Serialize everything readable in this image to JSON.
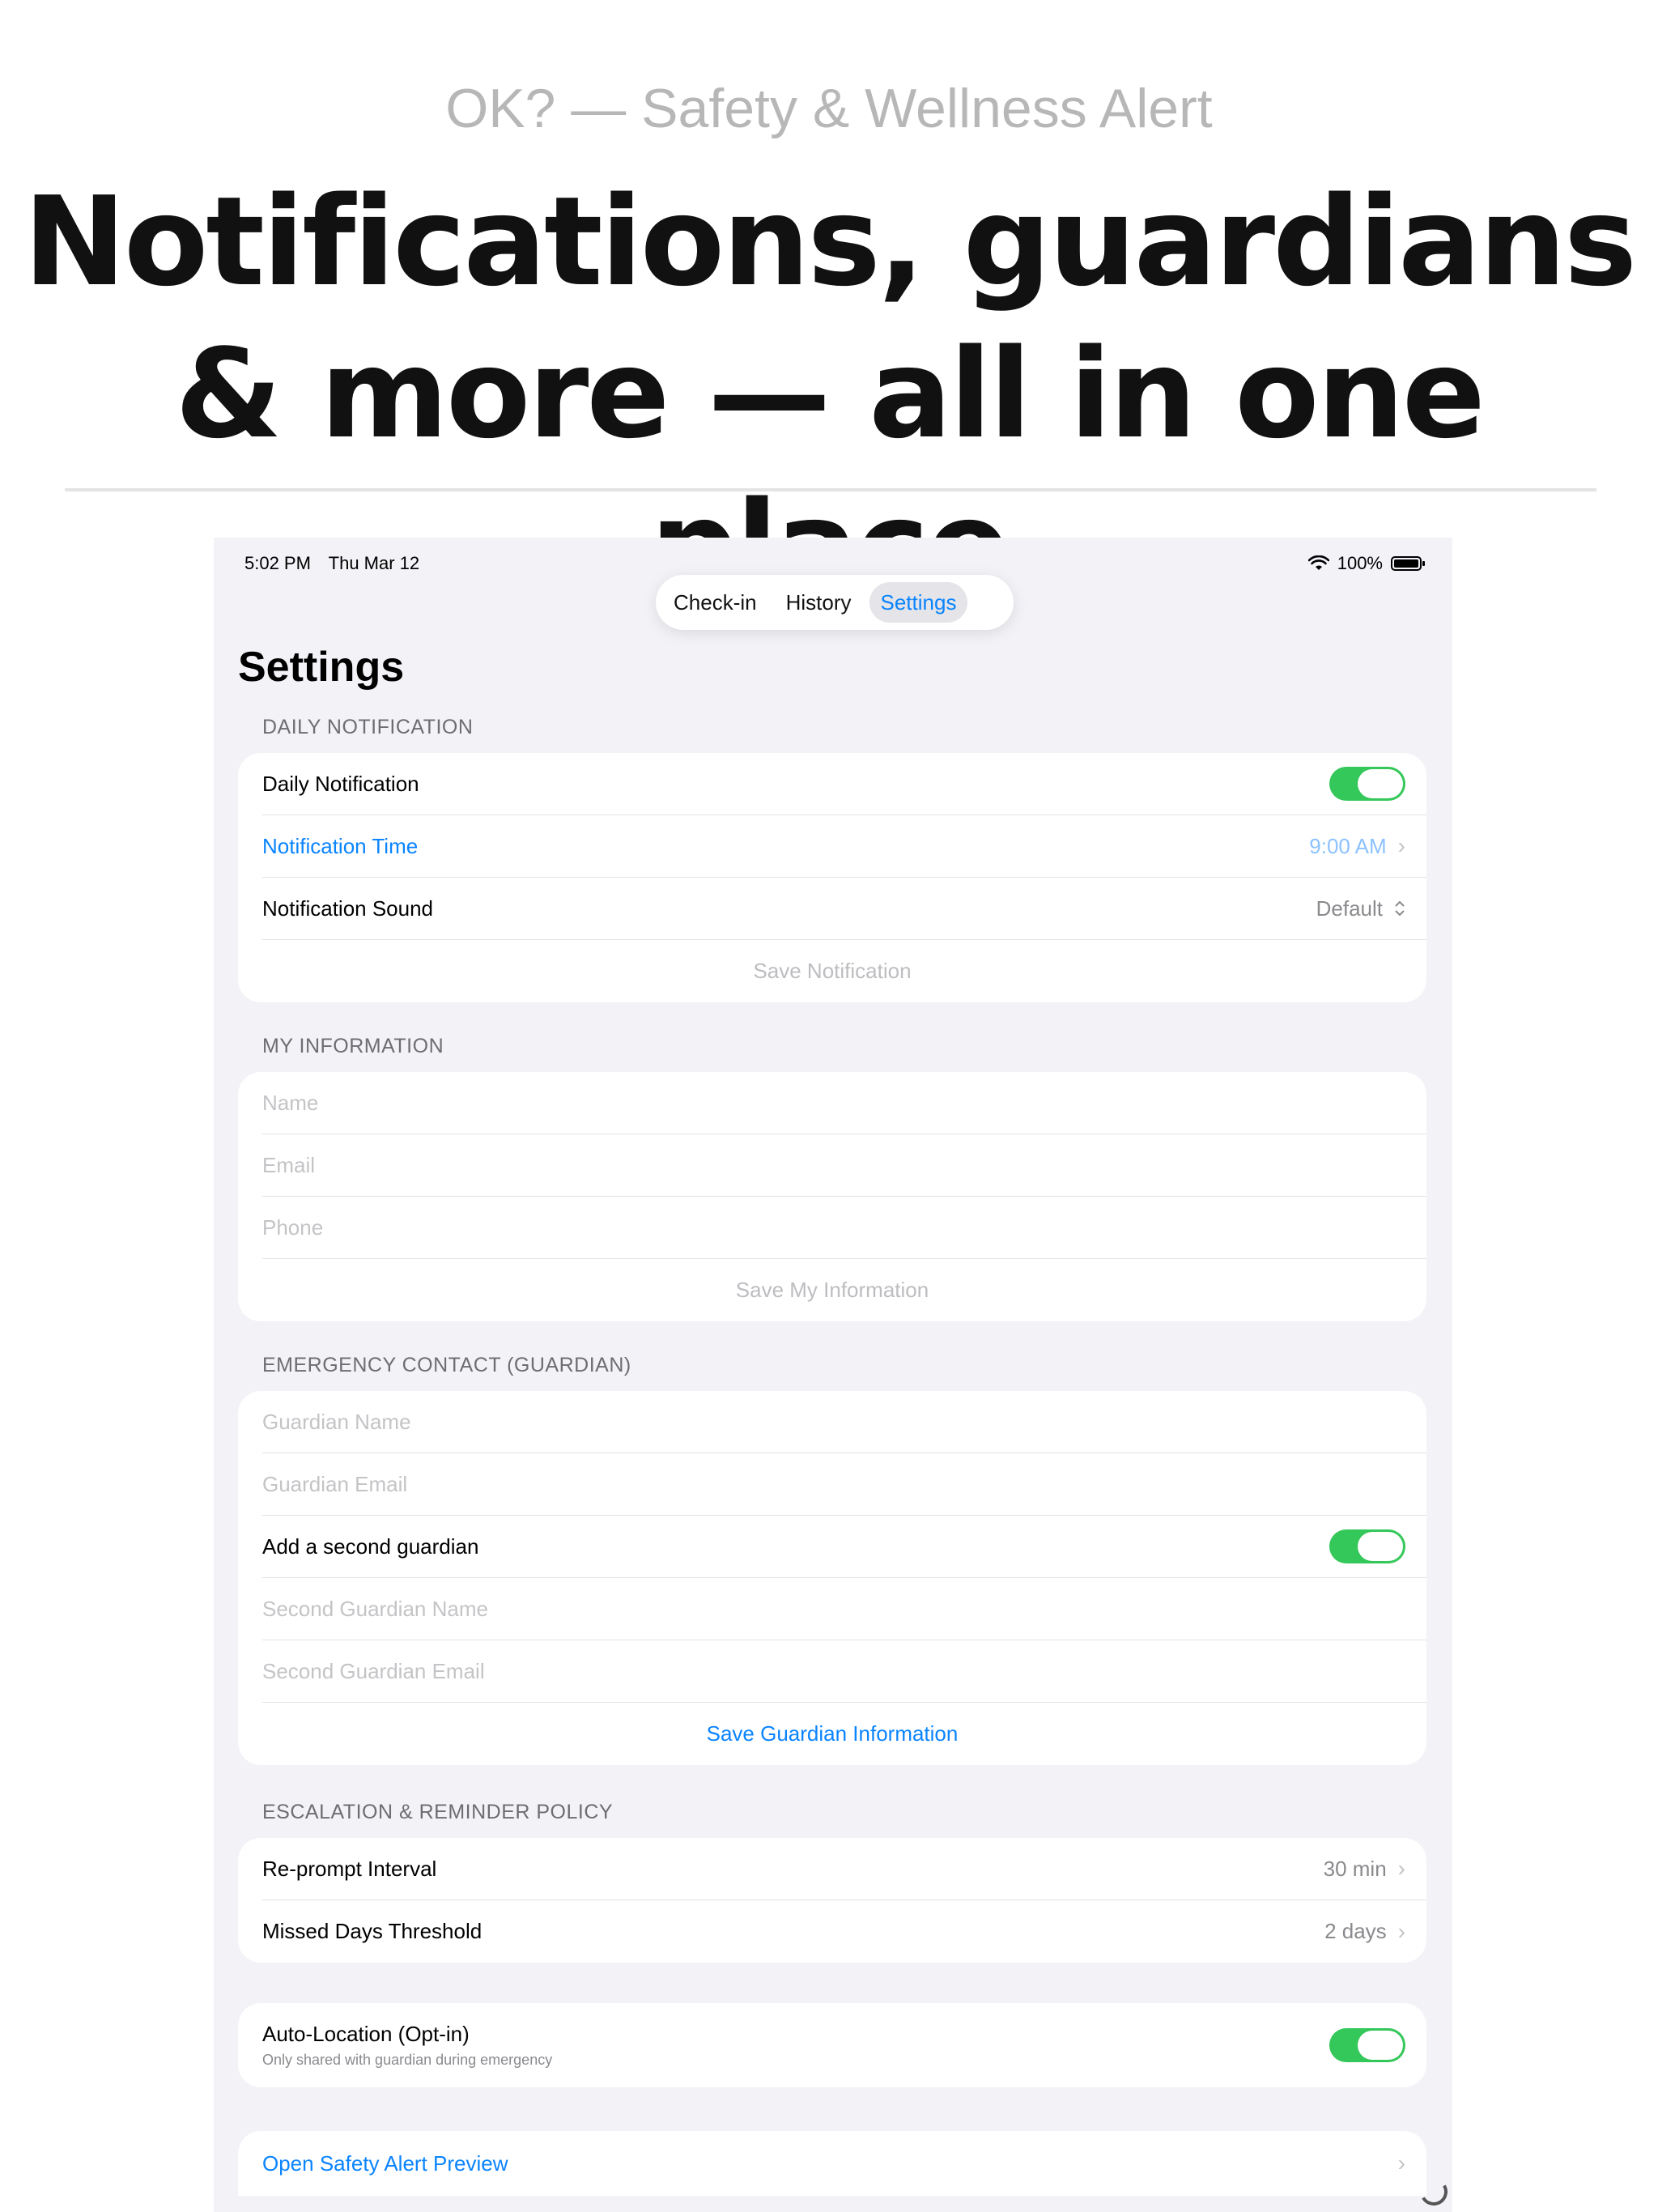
{
  "marketing": {
    "app_name": "OK? — Safety & Wellness Alert",
    "headline_line1": "Notifications, guardians",
    "headline_line2": "& more — all in one place"
  },
  "status_bar": {
    "time": "5:02 PM",
    "date": "Thu Mar 12",
    "battery": "100%"
  },
  "tabs": [
    {
      "label": "Check-in",
      "active": false
    },
    {
      "label": "History",
      "active": false
    },
    {
      "label": "Settings",
      "active": true
    }
  ],
  "page_title": "Settings",
  "daily_notification": {
    "header": "DAILY NOTIFICATION",
    "toggle_label": "Daily Notification",
    "toggle_on": true,
    "time_label": "Notification Time",
    "time_value": "9:00 AM",
    "sound_label": "Notification Sound",
    "sound_value": "Default",
    "save_label": "Save Notification"
  },
  "my_information": {
    "header": "MY INFORMATION",
    "name_placeholder": "Name",
    "email_placeholder": "Email",
    "phone_placeholder": "Phone",
    "save_label": "Save My Information"
  },
  "guardian": {
    "header": "EMERGENCY CONTACT (GUARDIAN)",
    "name_placeholder": "Guardian Name",
    "email_placeholder": "Guardian Email",
    "second_toggle_label": "Add a second guardian",
    "second_toggle_on": true,
    "second_name_placeholder": "Second Guardian Name",
    "second_email_placeholder": "Second Guardian Email",
    "save_label": "Save Guardian Information"
  },
  "escalation": {
    "header": "ESCALATION & REMINDER POLICY",
    "reprompt_label": "Re-prompt Interval",
    "reprompt_value": "30 min",
    "missed_label": "Missed Days Threshold",
    "missed_value": "2 days"
  },
  "location": {
    "label": "Auto-Location (Opt-in)",
    "sublabel": "Only shared with guardian during emergency",
    "toggle_on": true
  },
  "preview": {
    "label": "Open Safety Alert Preview"
  },
  "colors": {
    "accent": "#0a84ff",
    "toggle_on": "#34c759",
    "background": "#f2f2f7"
  }
}
